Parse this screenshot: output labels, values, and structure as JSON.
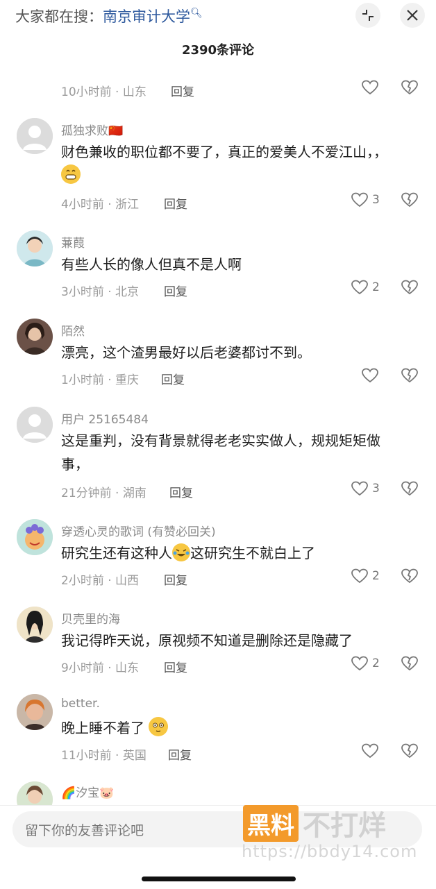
{
  "header": {
    "search_prefix": "大家都在搜：",
    "search_term": "南京审计大学",
    "title": "2390条评论",
    "partial_text": "' ' '"
  },
  "first_meta": {
    "time_loc": "10小时前 · 山东",
    "reply": "回复"
  },
  "comments": [
    {
      "user": "孤独求败🇨🇳",
      "text": "财色兼收的职位都不要了，真正的爱美人不爱江山，，",
      "emoji": "😁",
      "time_loc": "4小时前 · 浙江",
      "reply": "回复",
      "likes": "3"
    },
    {
      "user": "蒹葭",
      "text": "有些人长的像人但真不是人啊",
      "time_loc": "3小时前 · 北京",
      "reply": "回复",
      "likes": "2"
    },
    {
      "user": "陌然",
      "text": "漂亮，这个渣男最好以后老婆都讨不到。",
      "time_loc": "1小时前 · 重庆",
      "reply": "回复",
      "likes": ""
    },
    {
      "user": "用户 25165484",
      "text": "这是重判，没有背景就得老老实实做人，规规矩矩做事，",
      "time_loc": "21分钟前 · 湖南",
      "reply": "回复",
      "likes": "3"
    },
    {
      "user": "穿透心灵的歌词 (有赞必回关)",
      "text_a": "研究生还有这种人",
      "emoji": "🤣",
      "text_b": "这研究生不就白上了",
      "time_loc": "2小时前 · 山西",
      "reply": "回复",
      "likes": "2"
    },
    {
      "user": "贝壳里的海",
      "text": "我记得昨天说，原视频不知道是删除还是隐藏了",
      "time_loc": "9小时前 · 山东",
      "reply": "回复",
      "likes": "2"
    },
    {
      "user": "better.",
      "text": "晚上睡不着了",
      "emoji": "😳",
      "time_loc": "11小时前 · 英国",
      "reply": "回复",
      "likes": ""
    },
    {
      "user": "🌈汐宝🐷"
    }
  ],
  "footer": {
    "input_placeholder": "留下你的友善评论吧",
    "watermark_box": "黑料",
    "watermark_text": "不打烊",
    "watermark_url": "https://bbdy14.com"
  },
  "colors": {
    "link": "#2f5a9e",
    "watermark": "#f39a2b"
  }
}
